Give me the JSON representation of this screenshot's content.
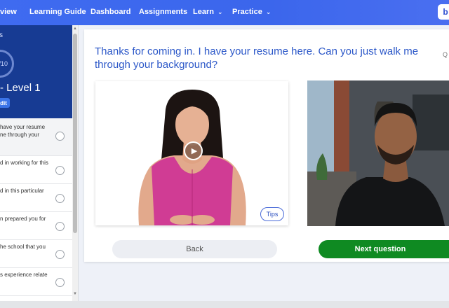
{
  "nav": {
    "items": [
      "view",
      "Learning Guide",
      "Dashboard",
      "Assignments",
      "Learn",
      "Practice"
    ],
    "badge": "b"
  },
  "sidebar": {
    "head_small": "s",
    "score": "/10",
    "level": "- Level 1",
    "edit_label": "dit",
    "questions": [
      "have your resume\nne through your",
      "d in working for this",
      "d in this particular",
      "n prepared you for",
      "he school that you",
      "s experience relate"
    ]
  },
  "main": {
    "question": "Thanks for coming in. I have your resume here. Can you just walk me through your background?",
    "corner_text": "Q",
    "tips_label": "Tips",
    "back_label": "Back",
    "next_label": "Next question"
  },
  "colors": {
    "nav_bg": "#3f6bf0",
    "sidebar_head": "#173b93",
    "question_text": "#2b57c8",
    "next_button": "#0f8a22"
  },
  "icons": {
    "play": "play-icon",
    "chevron": "chevron-down-icon"
  }
}
